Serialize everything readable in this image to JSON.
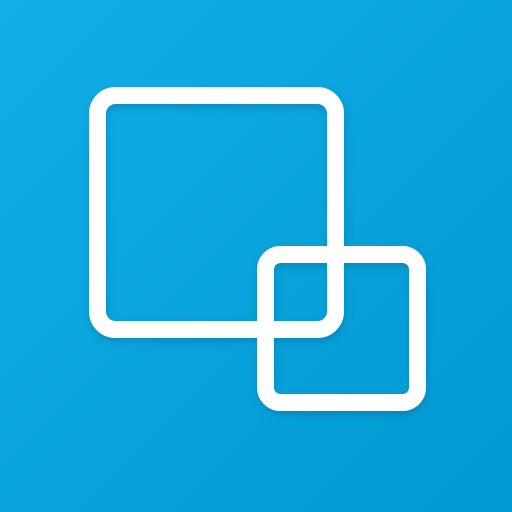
{
  "icon": {
    "name": "picture-in-picture-icon",
    "background_color": "#04A6E0",
    "background_color_light": "#12AEE7",
    "background_color_dark": "#0298D2",
    "frame_color": "#FFFFFF",
    "frame_shadow_color": "#0A5E86"
  }
}
